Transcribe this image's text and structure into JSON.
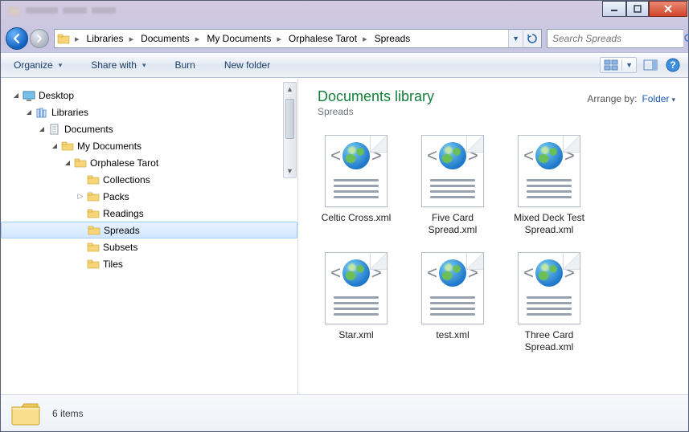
{
  "window_controls": {
    "minimize": "minimize",
    "maximize": "maximize",
    "close": "close"
  },
  "breadcrumb": [
    "Libraries",
    "Documents",
    "My Documents",
    "Orphalese Tarot",
    "Spreads"
  ],
  "search": {
    "placeholder": "Search Spreads"
  },
  "toolbar": {
    "organize": "Organize",
    "share": "Share with",
    "burn": "Burn",
    "newfolder": "New folder"
  },
  "library": {
    "title": "Documents library",
    "subtitle": "Spreads",
    "arrange_label": "Arrange by:",
    "arrange_value": "Folder"
  },
  "tree": {
    "desktop": "Desktop",
    "libraries": "Libraries",
    "documents": "Documents",
    "mydocuments": "My Documents",
    "orphalese": "Orphalese Tarot",
    "collections": "Collections",
    "packs": "Packs",
    "readings": "Readings",
    "spreads": "Spreads",
    "subsets": "Subsets",
    "tiles": "Tiles"
  },
  "files": [
    "Celtic Cross.xml",
    "Five Card Spread.xml",
    "Mixed Deck Test Spread.xml",
    "Star.xml",
    "test.xml",
    "Three Card Spread.xml"
  ],
  "status": {
    "items": "6 items"
  }
}
